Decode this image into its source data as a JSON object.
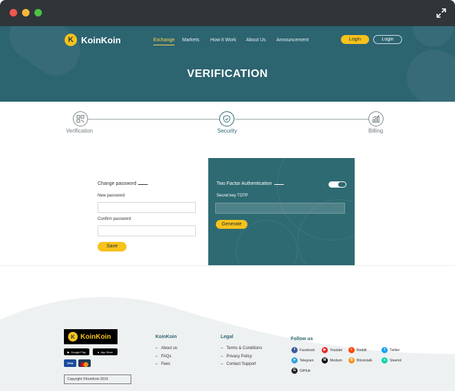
{
  "hero": {
    "brand": "KoinKoin",
    "brand_mark": "K",
    "nav": [
      "Exchange",
      "Markets",
      "How it Work",
      "About Us",
      "Announcement"
    ],
    "login_primary": "Login",
    "login_secondary": "Login",
    "title": "VERIFICATION"
  },
  "steps": [
    {
      "label": "Verification",
      "icon": "qr-code-icon"
    },
    {
      "label": "Security",
      "icon": "shield-icon",
      "active": true
    },
    {
      "label": "Billing",
      "icon": "chart-icon"
    }
  ],
  "password_form": {
    "title": "Change password",
    "new_label": "New password",
    "confirm_label": "Confirm password",
    "save_label": "Save"
  },
  "two_factor": {
    "title": "Two Factor Authentication",
    "enabled": true,
    "secret_label": "Secret key TOTP",
    "generate_label": "Generate"
  },
  "footer": {
    "brand": "KoinKoin",
    "google_play": "Google Play",
    "app_store": "App Store",
    "cards": [
      "VISA",
      "mastercard"
    ],
    "copyright": "Copyright ©KoinKoin 2019",
    "koinkoin_head": "KoinKoin",
    "koinkoin_links": [
      "About us",
      "FAQs",
      "Fees"
    ],
    "legal_head": "Legal",
    "legal_links": [
      "Terms & Conditions",
      "Privacy Policy",
      "Contact Support"
    ],
    "follow_head": "Follow us",
    "social": [
      {
        "name": "Facebook",
        "color": "#3b5998",
        "glyph": "f"
      },
      {
        "name": "Youtube",
        "color": "#e52d27",
        "glyph": "▶"
      },
      {
        "name": "Reddit",
        "color": "#ff4500",
        "glyph": "r"
      },
      {
        "name": "Twitter",
        "color": "#1da1f2",
        "glyph": "t"
      },
      {
        "name": "Telegram",
        "color": "#2aa3df",
        "glyph": "➤"
      },
      {
        "name": "Medium",
        "color": "#111111",
        "glyph": "M"
      },
      {
        "name": "Bitcointalk",
        "color": "#f7931a",
        "glyph": "B"
      },
      {
        "name": "Steemit",
        "color": "#06d6a9",
        "glyph": "s"
      },
      {
        "name": "GitHub",
        "color": "#222222",
        "glyph": "G"
      }
    ]
  },
  "colors": {
    "teal": "#2c6470",
    "accent_yellow": "#f6c21c"
  }
}
